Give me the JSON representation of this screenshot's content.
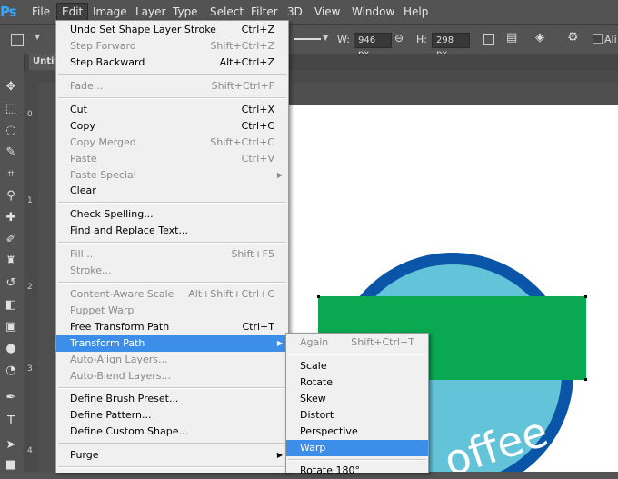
{
  "app": {
    "logo": "Ps"
  },
  "menubar": {
    "items": [
      "File",
      "Edit",
      "Image",
      "Layer",
      "Type",
      "Select",
      "Filter",
      "3D",
      "View",
      "Window",
      "Help"
    ]
  },
  "options": {
    "w_label": "W:",
    "w_value": "946 px",
    "h_label": "H:",
    "h_value": "298 px",
    "align_label": "Ali"
  },
  "document": {
    "tab_title": "Untit"
  },
  "ruler": {
    "left_marks": [
      "0",
      "1",
      "2",
      "3",
      "4"
    ]
  },
  "artwork": {
    "circle_outer_color": "#0a55a7",
    "circle_inner_color": "#63c4d9",
    "rect_color": "#0aa851",
    "text": "offee"
  },
  "edit_menu": {
    "items": [
      {
        "label": "Undo Set Shape Layer Stroke",
        "shortcut": "Ctrl+Z",
        "enabled": true
      },
      {
        "label": "Step Forward",
        "shortcut": "Shift+Ctrl+Z",
        "enabled": false
      },
      {
        "label": "Step Backward",
        "shortcut": "Alt+Ctrl+Z",
        "enabled": true
      },
      {
        "label": "Fade...",
        "shortcut": "Shift+Ctrl+F",
        "enabled": false
      },
      {
        "label": "Cut",
        "shortcut": "Ctrl+X",
        "enabled": true
      },
      {
        "label": "Copy",
        "shortcut": "Ctrl+C",
        "enabled": true
      },
      {
        "label": "Copy Merged",
        "shortcut": "Shift+Ctrl+C",
        "enabled": false
      },
      {
        "label": "Paste",
        "shortcut": "Ctrl+V",
        "enabled": false
      },
      {
        "label": "Paste Special",
        "shortcut": "",
        "enabled": false,
        "submenu": true
      },
      {
        "label": "Clear",
        "shortcut": "",
        "enabled": true
      },
      {
        "label": "Check Spelling...",
        "shortcut": "",
        "enabled": true
      },
      {
        "label": "Find and Replace Text...",
        "shortcut": "",
        "enabled": true
      },
      {
        "label": "Fill...",
        "shortcut": "Shift+F5",
        "enabled": false
      },
      {
        "label": "Stroke...",
        "shortcut": "",
        "enabled": false
      },
      {
        "label": "Content-Aware Scale",
        "shortcut": "Alt+Shift+Ctrl+C",
        "enabled": false
      },
      {
        "label": "Puppet Warp",
        "shortcut": "",
        "enabled": false
      },
      {
        "label": "Free Transform Path",
        "shortcut": "Ctrl+T",
        "enabled": true
      },
      {
        "label": "Transform Path",
        "shortcut": "",
        "enabled": true,
        "submenu": true,
        "highlighted": true
      },
      {
        "label": "Auto-Align Layers...",
        "shortcut": "",
        "enabled": false
      },
      {
        "label": "Auto-Blend Layers...",
        "shortcut": "",
        "enabled": false
      },
      {
        "label": "Define Brush Preset...",
        "shortcut": "",
        "enabled": true
      },
      {
        "label": "Define Pattern...",
        "shortcut": "",
        "enabled": true
      },
      {
        "label": "Define Custom Shape...",
        "shortcut": "",
        "enabled": true
      },
      {
        "label": "Purge",
        "shortcut": "",
        "enabled": true,
        "submenu": true
      }
    ]
  },
  "transform_menu": {
    "items": [
      {
        "label": "Again",
        "shortcut": "Shift+Ctrl+T",
        "enabled": false
      },
      {
        "label": "Scale",
        "shortcut": "",
        "enabled": true
      },
      {
        "label": "Rotate",
        "shortcut": "",
        "enabled": true
      },
      {
        "label": "Skew",
        "shortcut": "",
        "enabled": true
      },
      {
        "label": "Distort",
        "shortcut": "",
        "enabled": true
      },
      {
        "label": "Perspective",
        "shortcut": "",
        "enabled": true
      },
      {
        "label": "Warp",
        "shortcut": "",
        "enabled": true,
        "highlighted": true
      },
      {
        "label": "Rotate 180°",
        "shortcut": "",
        "enabled": true
      }
    ]
  }
}
